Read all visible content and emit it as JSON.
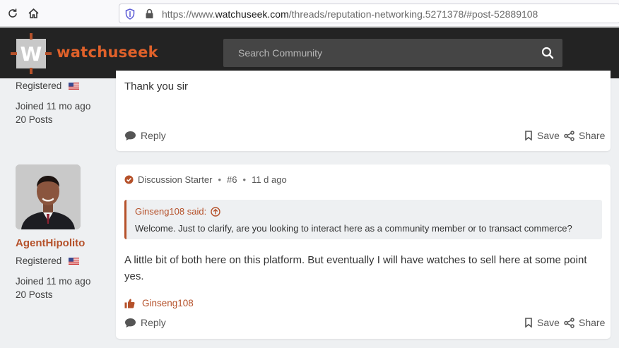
{
  "browser": {
    "url_prefix": "https://www.",
    "url_host": "watchuseek.com",
    "url_path": "/threads/reputation-networking.5271378/#post-52889108"
  },
  "header": {
    "logo_letter": "W",
    "logo_text": "watchuseek",
    "search_placeholder": "Search Community"
  },
  "post1": {
    "user_role": "Registered",
    "joined": "Joined 11 mo ago",
    "posts": "20 Posts",
    "body": "Thank you sir",
    "reply_label": "Reply",
    "save_label": "Save",
    "share_label": "Share"
  },
  "post2": {
    "username": "AgentHipolito",
    "user_role": "Registered",
    "joined": "Joined 11 mo ago",
    "posts": "20 Posts",
    "badge": "Discussion Starter",
    "post_number": "#6",
    "time": "11 d ago",
    "quote_author": "Ginseng108 said:",
    "quote_text": "Welcome. Just to clarify, are you looking to interact here as a community member or to transact commerce?",
    "body_line1": "A little bit of both here on this platform. But eventually I will have watches to sell here at some point",
    "body_line2": "yes.",
    "liked_by": "Ginseng108",
    "reply_label": "Reply",
    "save_label": "Save",
    "share_label": "Share"
  },
  "colors": {
    "accent": "#b5512a",
    "header_bg": "#232323",
    "page_bg": "#eef0f2"
  }
}
